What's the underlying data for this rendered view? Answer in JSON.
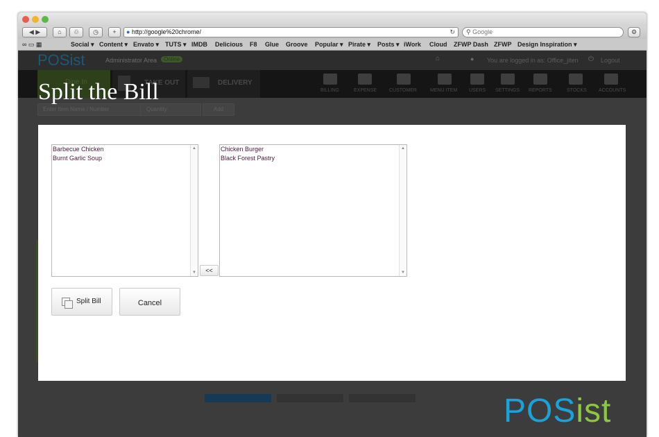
{
  "browser": {
    "url": "http://google%20chrome/",
    "search_placeholder": "Google",
    "bookmarks": [
      "Social ▾",
      "Content ▾",
      "Envato ▾",
      "TUTS ▾",
      "IMDB",
      "Delicious",
      "F8",
      "Glue",
      "Groove",
      "Popular ▾",
      "Pirate ▾",
      "Posts ▾",
      "iWork",
      "Cloud",
      "ZFWP Dash",
      "ZFWP",
      "Design Inspiration ▾"
    ]
  },
  "app": {
    "brand": "POSist",
    "area_label": "Administrator Area",
    "status_badge": "Online",
    "logged_in_text": "You are logged in as: Office_jiten",
    "logout_label": "Logout",
    "order_tabs": [
      "Dine In",
      "TAKE OUT",
      "DELIVERY"
    ],
    "nav_items": [
      "BILLING",
      "EXPENSE",
      "CUSTOMER",
      "MENU ITEM",
      "USERS",
      "SETTINGS",
      "REPORTS",
      "STOCKS",
      "ACCOUNTS"
    ],
    "item_placeholder": "Enter Item Name / Number",
    "quantity_placeholder": "Quantity",
    "add_label": "Add"
  },
  "overlay_title": "Split the Bill",
  "dialog": {
    "left_items": [
      "Barbecue Chicken",
      "Burnt Garlic Soup"
    ],
    "right_items": [
      "Chicken Burger",
      "Black Forest Pastry"
    ],
    "move_label": "<<",
    "split_label": "Split Bill",
    "cancel_label": "Cancel"
  },
  "logo": {
    "part1": "POS",
    "part2": "ist",
    "color1": "#1aa3d9",
    "color2": "#8dc63f"
  }
}
